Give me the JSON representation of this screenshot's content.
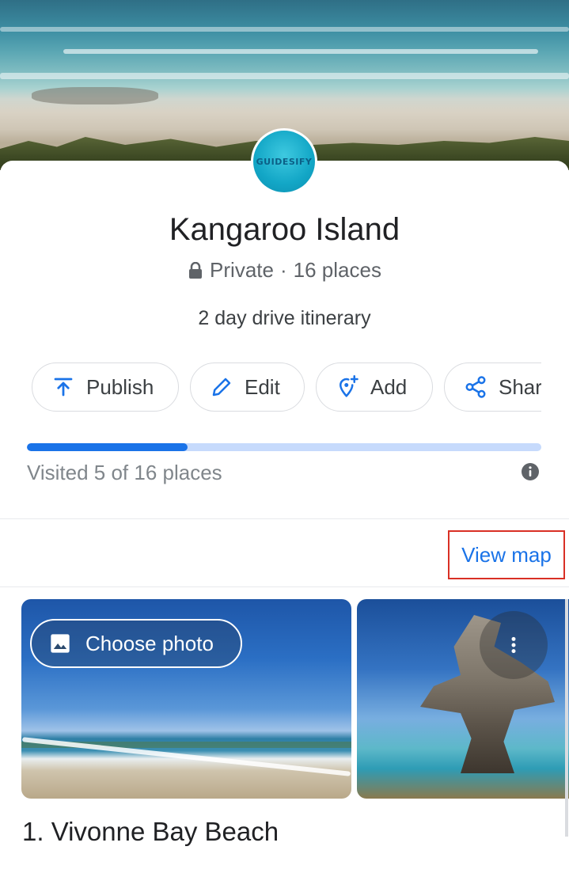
{
  "list": {
    "title": "Kangaroo Island",
    "privacy": "Private",
    "separator": "·",
    "places_count": "16 places",
    "description": "2 day drive itinerary",
    "avatar_text": "GUIDESIFY"
  },
  "actions": [
    {
      "label": "Publish",
      "icon": "upload-icon"
    },
    {
      "label": "Edit",
      "icon": "pencil-icon"
    },
    {
      "label": "Add",
      "icon": "add-place-icon"
    },
    {
      "label": "Share",
      "icon": "share-icon"
    }
  ],
  "progress": {
    "visited": 5,
    "total": 16,
    "fraction": 0.3125,
    "text": "Visited 5 of 16 places"
  },
  "view_map_label": "View map",
  "places": [
    {
      "title": "1. Vivonne Bay Beach",
      "photo_action": "Choose photo"
    }
  ],
  "colors": {
    "accent": "#1a73e8",
    "progress_track": "#c6dafc",
    "highlight_box": "#d93025"
  }
}
